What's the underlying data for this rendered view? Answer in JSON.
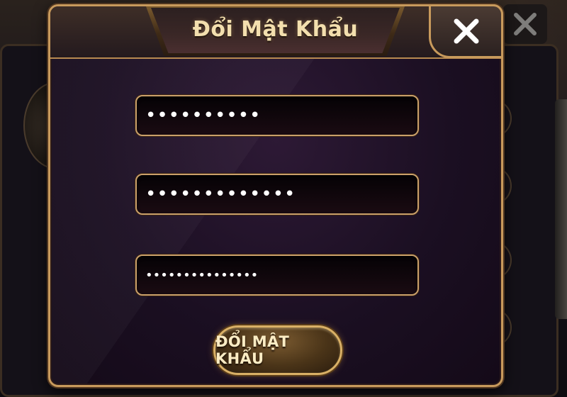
{
  "dialog": {
    "title": "Đổi Mật Khẩu",
    "close_icon": "close-icon",
    "fields": [
      {
        "value": "••••••••••"
      },
      {
        "value": "•••••••••••••"
      },
      {
        "value": "•••••••••••••••"
      }
    ],
    "submit_label": "ĐỔI MẬT KHẨU"
  },
  "background": {
    "close_icon": "close-icon"
  },
  "colors": {
    "gold_border": "#c89a5c",
    "title_text": "#f3dfae",
    "dialog_bg": "#1b0f22"
  }
}
